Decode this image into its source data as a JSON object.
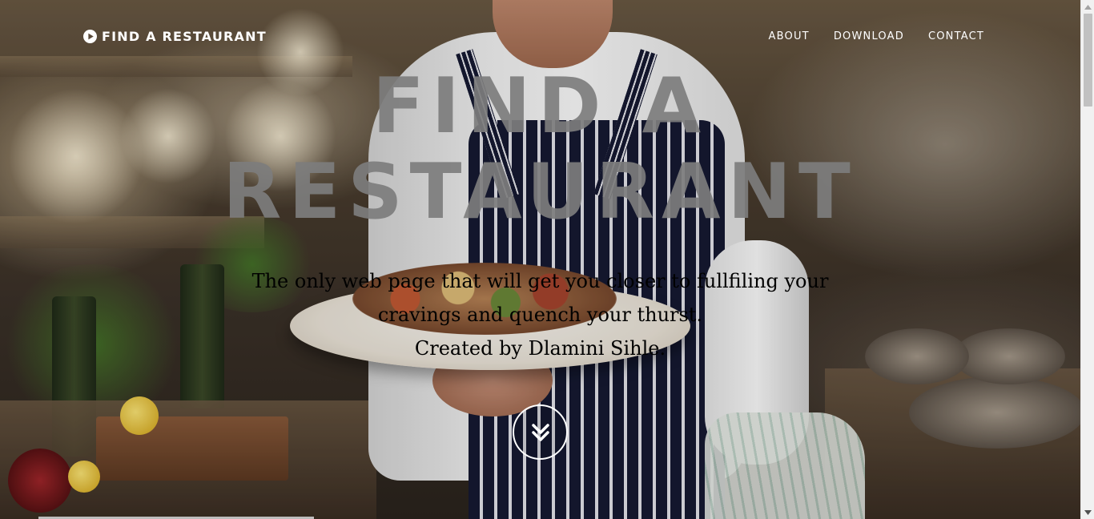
{
  "brand": {
    "name": "FIND A RESTAURANT",
    "icon": "play-circle-icon",
    "color": "#ffffff"
  },
  "nav": {
    "items": [
      {
        "label": "ABOUT"
      },
      {
        "label": "DOWNLOAD"
      },
      {
        "label": "CONTACT"
      }
    ]
  },
  "hero": {
    "title_lines": [
      "FIND A",
      "RESTAURANT"
    ],
    "title_color": "#7d7d7d",
    "tagline_lines": [
      "The only web page that will get you closer to fullfiling your",
      "cravings and quench your thurst.",
      "Created by Dlamini Sihle."
    ],
    "tagline_color": "#000000",
    "scroll_icon": "double-chevron-down-icon"
  },
  "scrollbar": {
    "up_icon": "scroll-up-arrow-icon",
    "down_icon": "scroll-down-arrow-icon",
    "track_color": "#f1f1f1",
    "thumb_color": "#c1c1c1"
  }
}
